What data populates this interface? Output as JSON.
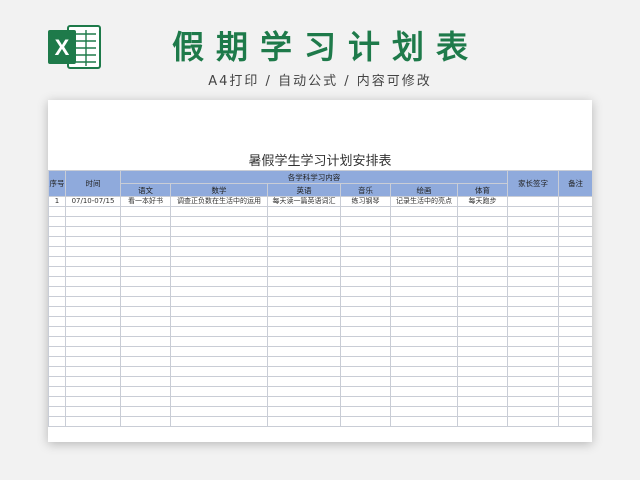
{
  "banner": {
    "title": "假期学习计划表",
    "subtitle": "A4打印 / 自动公式 / 内容可修改",
    "logo_icon": "excel-icon",
    "logo_letter": "X",
    "brand_color": "#1e7a4a"
  },
  "sheet": {
    "title": "暑假学生学习计划安排表",
    "header_color": "#8faadc",
    "headers": {
      "seq": "序号",
      "time": "时间",
      "group": "各学科学习内容",
      "parent_sign": "家长签字",
      "remark": "备注",
      "subjects": [
        "语文",
        "数学",
        "英语",
        "音乐",
        "绘画",
        "体育"
      ]
    },
    "rows": [
      {
        "seq": "1",
        "time": "07/10-07/15",
        "cells": [
          "看一本好书",
          "调查正负数在生活中的运用",
          "每天读一篇英语词汇",
          "练习钢琴",
          "记录生活中的亮点",
          "每天跑步"
        ],
        "parent_sign": "",
        "remark": ""
      }
    ]
  }
}
